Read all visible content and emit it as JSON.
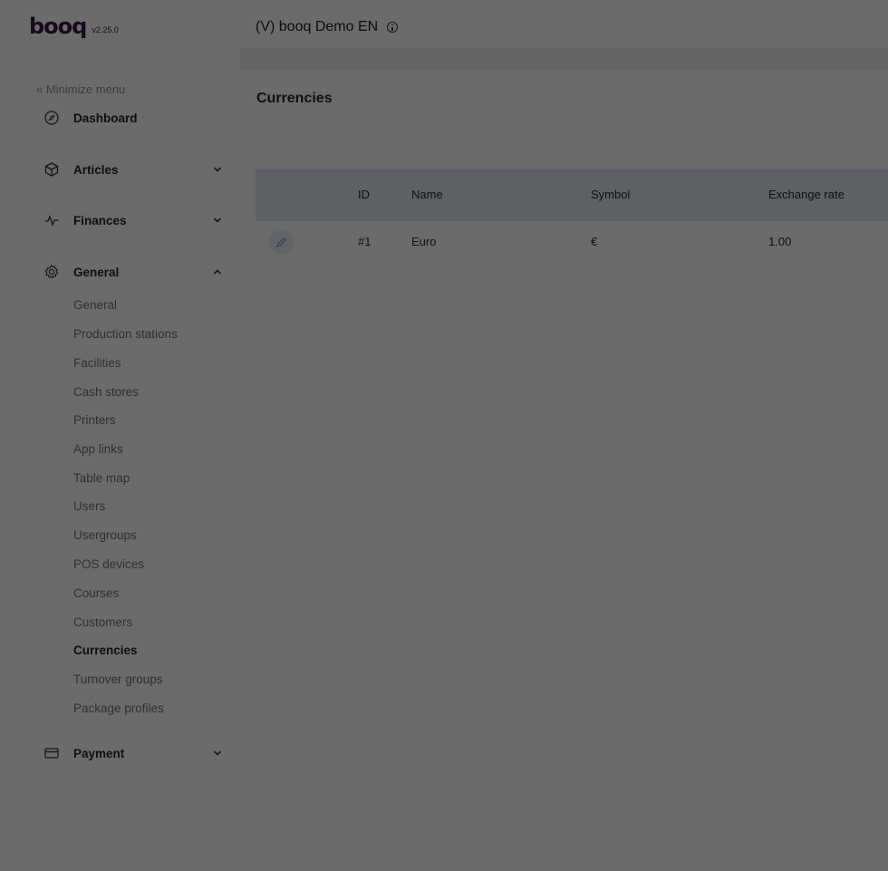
{
  "header": {
    "brand": "booq",
    "version": "v2.25.0",
    "venue": "(V) booq Demo EN"
  },
  "sidebar": {
    "minimize_label": "« Minimize menu",
    "sections": [
      {
        "label": "Dashboard",
        "icon": "compass-icon"
      },
      {
        "label": "Articles",
        "icon": "box-icon",
        "expanded": false
      },
      {
        "label": "Finances",
        "icon": "pulse-icon",
        "expanded": false
      },
      {
        "label": "General",
        "icon": "gear-icon",
        "expanded": true
      },
      {
        "label": "Payment",
        "icon": "credit-card-icon",
        "expanded": false
      }
    ],
    "general_items": [
      "General",
      "Production stations",
      "Facilities",
      "Cash stores",
      "Printers",
      "App links",
      "Table map",
      "Users",
      "Usergroups",
      "POS devices",
      "Courses",
      "Customers",
      "Currencies",
      "Turnover groups",
      "Package profiles"
    ],
    "active_item": "Currencies"
  },
  "main": {
    "title": "Currencies",
    "table": {
      "columns": [
        "ID",
        "Name",
        "Symbol",
        "Exchange rate"
      ],
      "rows": [
        {
          "id": "#1",
          "name": "Euro",
          "symbol": "€",
          "rate": "1.00"
        }
      ]
    }
  },
  "colors": {
    "brand": "#3a1247",
    "table_header_bg": "#dde7f1",
    "overlay": "rgba(0,0,0,0.58)"
  }
}
